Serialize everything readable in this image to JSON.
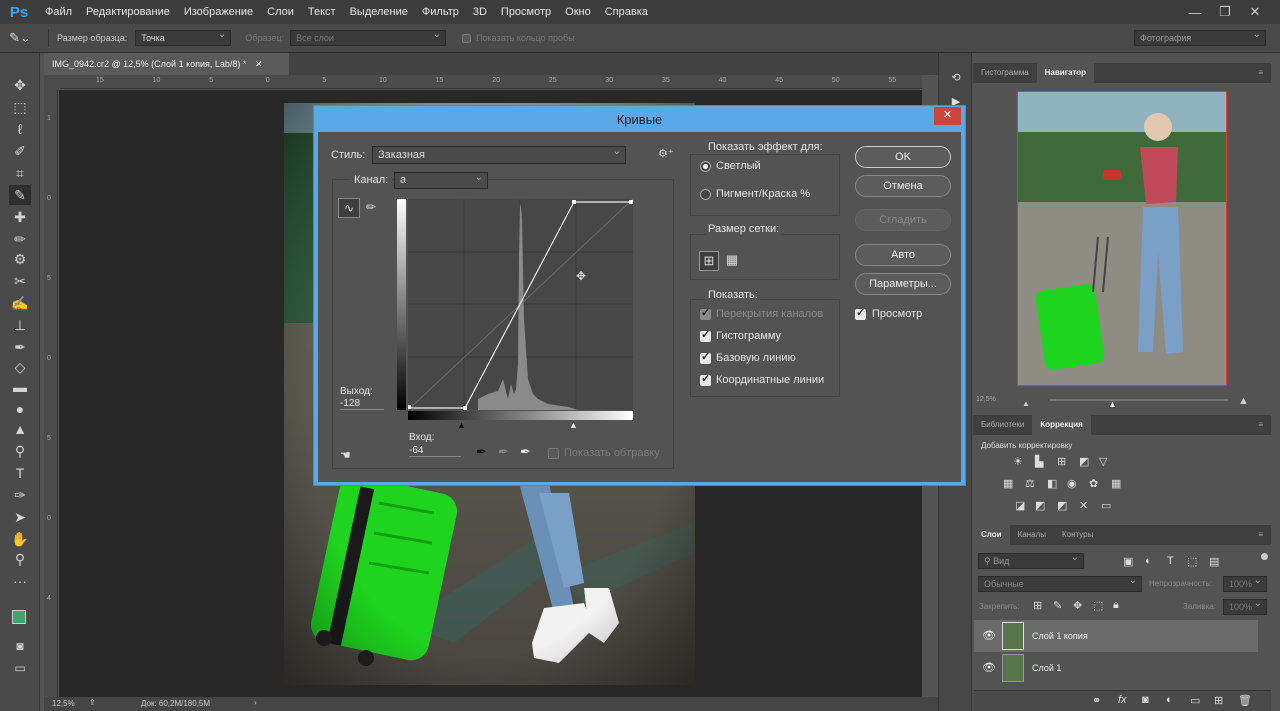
{
  "app": {
    "logo": "Ps"
  },
  "menu": [
    "Файл",
    "Редактирование",
    "Изображение",
    "Слои",
    "Текст",
    "Выделение",
    "Фильтр",
    "3D",
    "Просмотр",
    "Окно",
    "Справка"
  ],
  "options": {
    "sample_size_label": "Размер образца:",
    "sample_size_value": "Точка",
    "sample_label": "Образец:",
    "sample_value": "Все слои",
    "show_ring_label": "Показать кольцо пробы",
    "workspace": "Фотография"
  },
  "document": {
    "tab_title": "IMG_0942.cr2 @ 12,5% (Слой 1 копия, Lab/8) *",
    "zoom": "12,5%",
    "doc_size": "Док: 60,2M/180,5M",
    "ruler_h": [
      "15",
      "10",
      "5",
      "0",
      "5",
      "10",
      "15",
      "20",
      "25",
      "30",
      "35",
      "40",
      "45",
      "50",
      "55"
    ],
    "ruler_v": [
      "1",
      "0",
      "5",
      "0",
      "5",
      "0",
      "4"
    ]
  },
  "curves": {
    "title": "Кривые",
    "close": "✕",
    "style_label": "Стиль:",
    "style_value": "Заказная",
    "channel_label": "Канал:",
    "channel_value": "a",
    "output_label": "Выход:",
    "output_value": "-128",
    "input_label": "Вход:",
    "input_value": "-64",
    "show_clipping": "Показать обтравку",
    "show_effect_title": "Показать эффект для:",
    "effect_light": "Светлый",
    "effect_pigment": "Пигмент/Краска %",
    "grid_size_title": "Размер сетки:",
    "show_title": "Показать:",
    "opt_channel_overlays": "Перекрытия каналов",
    "opt_histogram": "Гистограмму",
    "opt_baseline": "Базовую линию",
    "opt_intersection": "Координатные линии",
    "btn_ok": "OK",
    "btn_cancel": "Отмена",
    "btn_smooth": "Сгладить",
    "btn_auto": "Авто",
    "btn_options": "Параметры...",
    "preview_label": "Просмотр"
  },
  "navigator": {
    "tab_histogram": "Гистограмма",
    "tab_navigator": "Навигатор",
    "zoom": "12,5%"
  },
  "adjustments": {
    "tab_libraries": "Библиотеки",
    "tab_correction": "Коррекция",
    "add_label": "Добавить корректировку"
  },
  "layers": {
    "tab_layers": "Слои",
    "tab_channels": "Каналы",
    "tab_paths": "Контуры",
    "filter_label": "Вид",
    "blend_mode": "Обычные",
    "opacity_label": "Непрозрачность:",
    "opacity_value": "100%",
    "lock_label": "Закрепить:",
    "fill_label": "Заливка:",
    "fill_value": "100%",
    "items": [
      {
        "name": "Слой 1 копия"
      },
      {
        "name": "Слой 1"
      }
    ]
  }
}
